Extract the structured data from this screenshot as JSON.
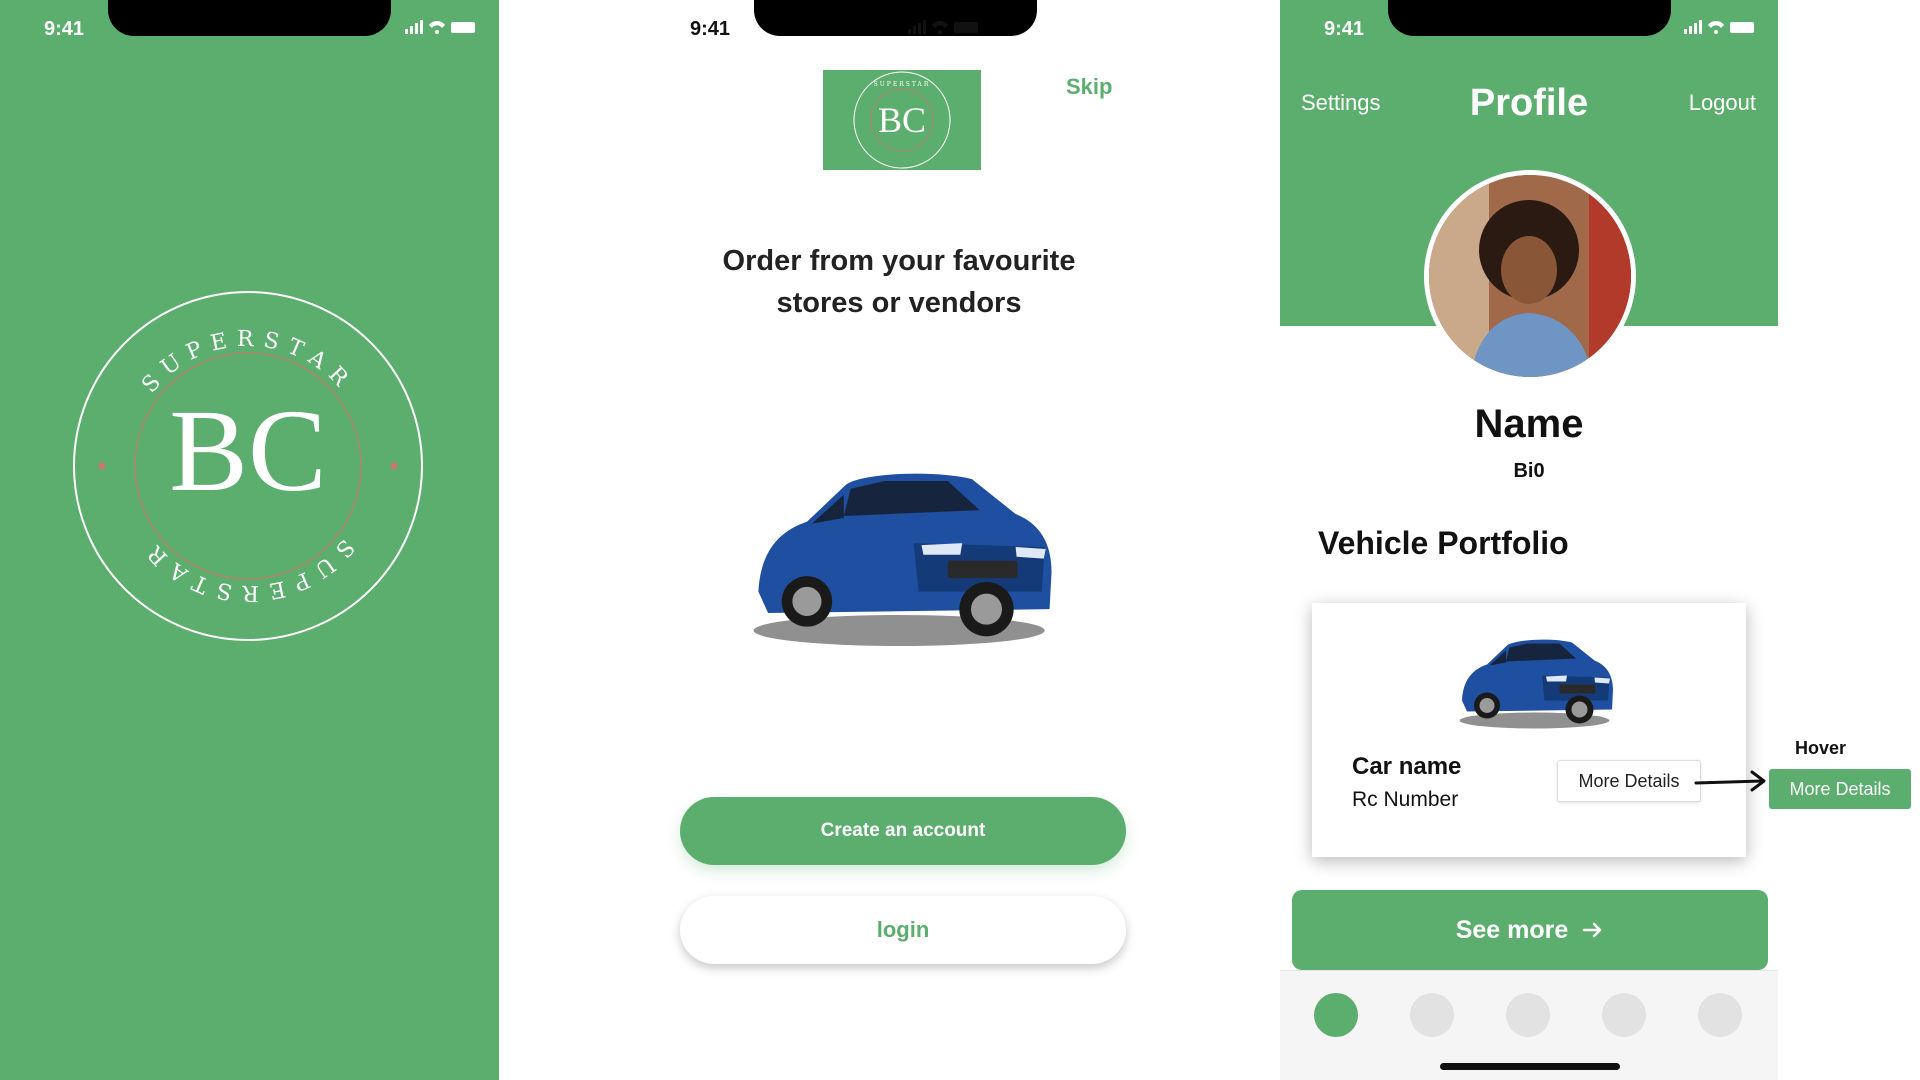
{
  "theme": {
    "accent": "#5cae6e",
    "background": "#ffffff",
    "text": "#111111"
  },
  "splash": {
    "status": {
      "time": "9:41"
    },
    "logo": {
      "ring_text": "SUPERSTAR",
      "monogram": "BC"
    }
  },
  "onboarding": {
    "status": {
      "time": "9:41"
    },
    "logo": {
      "ring_text": "SUPERSTAR",
      "monogram": "BC"
    },
    "skip_label": "Skip",
    "headline": "Order from your favourite stores or vendors",
    "hero_image": "blue-hatchback-car",
    "create_account_label": "Create an account",
    "login_label": "login"
  },
  "profile": {
    "status": {
      "time": "9:41"
    },
    "header": {
      "settings_label": "Settings",
      "title": "Profile",
      "logout_label": "Logout"
    },
    "avatar": "user-avatar-photo",
    "name": "Name",
    "bio": "Bi0",
    "section_title": "Vehicle Portfolio",
    "card": {
      "image": "blue-hatchback-car",
      "car_name": "Car name",
      "rc_number": "Rc Number",
      "details_label": "More Details"
    },
    "see_more_label": "See more",
    "tabs": [
      {
        "icon": "tab-dot",
        "active": true
      },
      {
        "icon": "tab-dot",
        "active": false
      },
      {
        "icon": "tab-dot",
        "active": false
      },
      {
        "icon": "tab-dot",
        "active": false
      },
      {
        "icon": "tab-dot",
        "active": false
      }
    ]
  },
  "hover_annotation": {
    "label": "Hover",
    "button_label": "More Details"
  }
}
